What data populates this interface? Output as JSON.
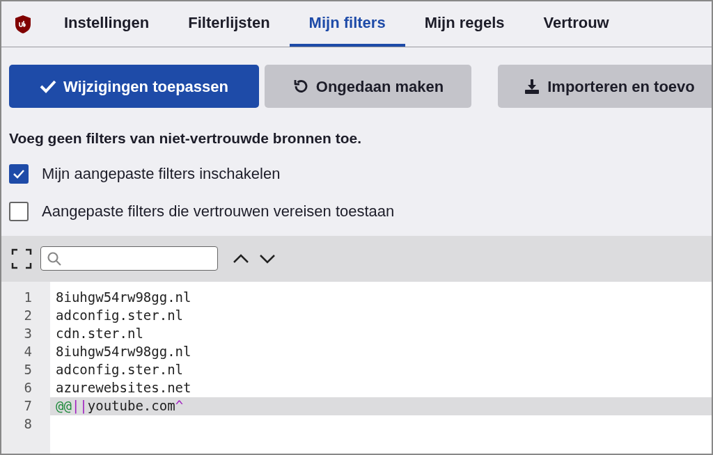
{
  "tabs": [
    {
      "label": "Instellingen",
      "selected": false
    },
    {
      "label": "Filterlijsten",
      "selected": false
    },
    {
      "label": "Mijn filters",
      "selected": true
    },
    {
      "label": "Mijn regels",
      "selected": false
    },
    {
      "label": "Vertrouw",
      "selected": false
    }
  ],
  "buttons": [
    {
      "label": "Wijzigingen toepassen",
      "kind": "apply"
    },
    {
      "label": "Ongedaan maken",
      "kind": "undo"
    },
    {
      "label": "Importeren en toevo",
      "kind": "import"
    }
  ],
  "warning": "Voeg geen filters van niet-vertrouwde bronnen toe.",
  "options": [
    {
      "label": "Mijn aangepaste filters inschakelen",
      "checked": true
    },
    {
      "label": "Aangepaste filters die vertrouwen vereisen toestaan",
      "checked": false
    }
  ],
  "editor": {
    "lines": [
      {
        "number": "1",
        "active": false,
        "tokens": [
          {
            "text": "8iuhgw54rw98gg.nl",
            "kind": "plain"
          }
        ]
      },
      {
        "number": "2",
        "active": false,
        "tokens": [
          {
            "text": "adconfig.ster.nl",
            "kind": "plain"
          }
        ]
      },
      {
        "number": "3",
        "active": false,
        "tokens": [
          {
            "text": "cdn.ster.nl",
            "kind": "plain"
          }
        ]
      },
      {
        "number": "4",
        "active": false,
        "tokens": [
          {
            "text": "8iuhgw54rw98gg.nl",
            "kind": "plain"
          }
        ]
      },
      {
        "number": "5",
        "active": false,
        "tokens": [
          {
            "text": "adconfig.ster.nl",
            "kind": "plain"
          }
        ]
      },
      {
        "number": "6",
        "active": false,
        "tokens": [
          {
            "text": "azurewebsites.net",
            "kind": "plain"
          }
        ]
      },
      {
        "number": "7",
        "active": true,
        "tokens": [
          {
            "text": "@@",
            "kind": "exception"
          },
          {
            "text": "||",
            "kind": "anchor"
          },
          {
            "text": "youtube.com",
            "kind": "plain"
          },
          {
            "text": "^",
            "kind": "anchor"
          }
        ]
      },
      {
        "number": "8",
        "active": false
      }
    ]
  }
}
